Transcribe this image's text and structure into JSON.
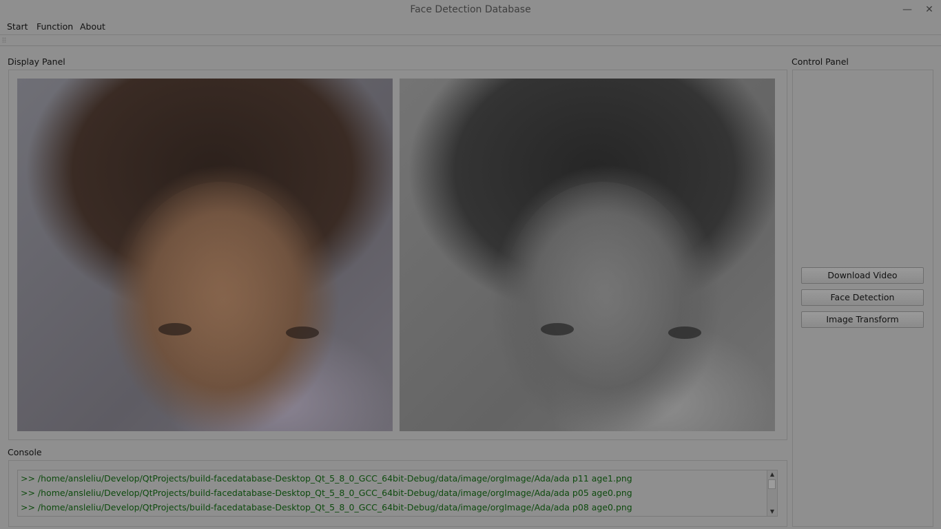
{
  "window": {
    "title": "Face Detection Database",
    "minimize_glyph": "—",
    "close_glyph": "✕"
  },
  "menu": {
    "items": [
      {
        "label": "Start"
      },
      {
        "label": "Function"
      },
      {
        "label": "About"
      }
    ]
  },
  "display_panel": {
    "label": "Display Panel",
    "images": [
      {
        "name": "original-color-image"
      },
      {
        "name": "grayscale-transformed-image"
      }
    ]
  },
  "control_panel": {
    "label": "Control Panel",
    "buttons": [
      {
        "label": "Download Video"
      },
      {
        "label": "Face Detection"
      },
      {
        "label": "Image Transform"
      }
    ]
  },
  "console": {
    "label": "Console",
    "lines": [
      ">> /home/ansleliu/Develop/QtProjects/build-facedatabase-Desktop_Qt_5_8_0_GCC_64bit-Debug/data/image/orgImage/Ada/ada p11 age1.png",
      ">> /home/ansleliu/Develop/QtProjects/build-facedatabase-Desktop_Qt_5_8_0_GCC_64bit-Debug/data/image/orgImage/Ada/ada p05 age0.png",
      ">> /home/ansleliu/Develop/QtProjects/build-facedatabase-Desktop_Qt_5_8_0_GCC_64bit-Debug/data/image/orgImage/Ada/ada p08 age0.png"
    ],
    "text_color": "#0d4a0d"
  },
  "scrollbar": {
    "up_glyph": "▲",
    "down_glyph": "▼"
  }
}
